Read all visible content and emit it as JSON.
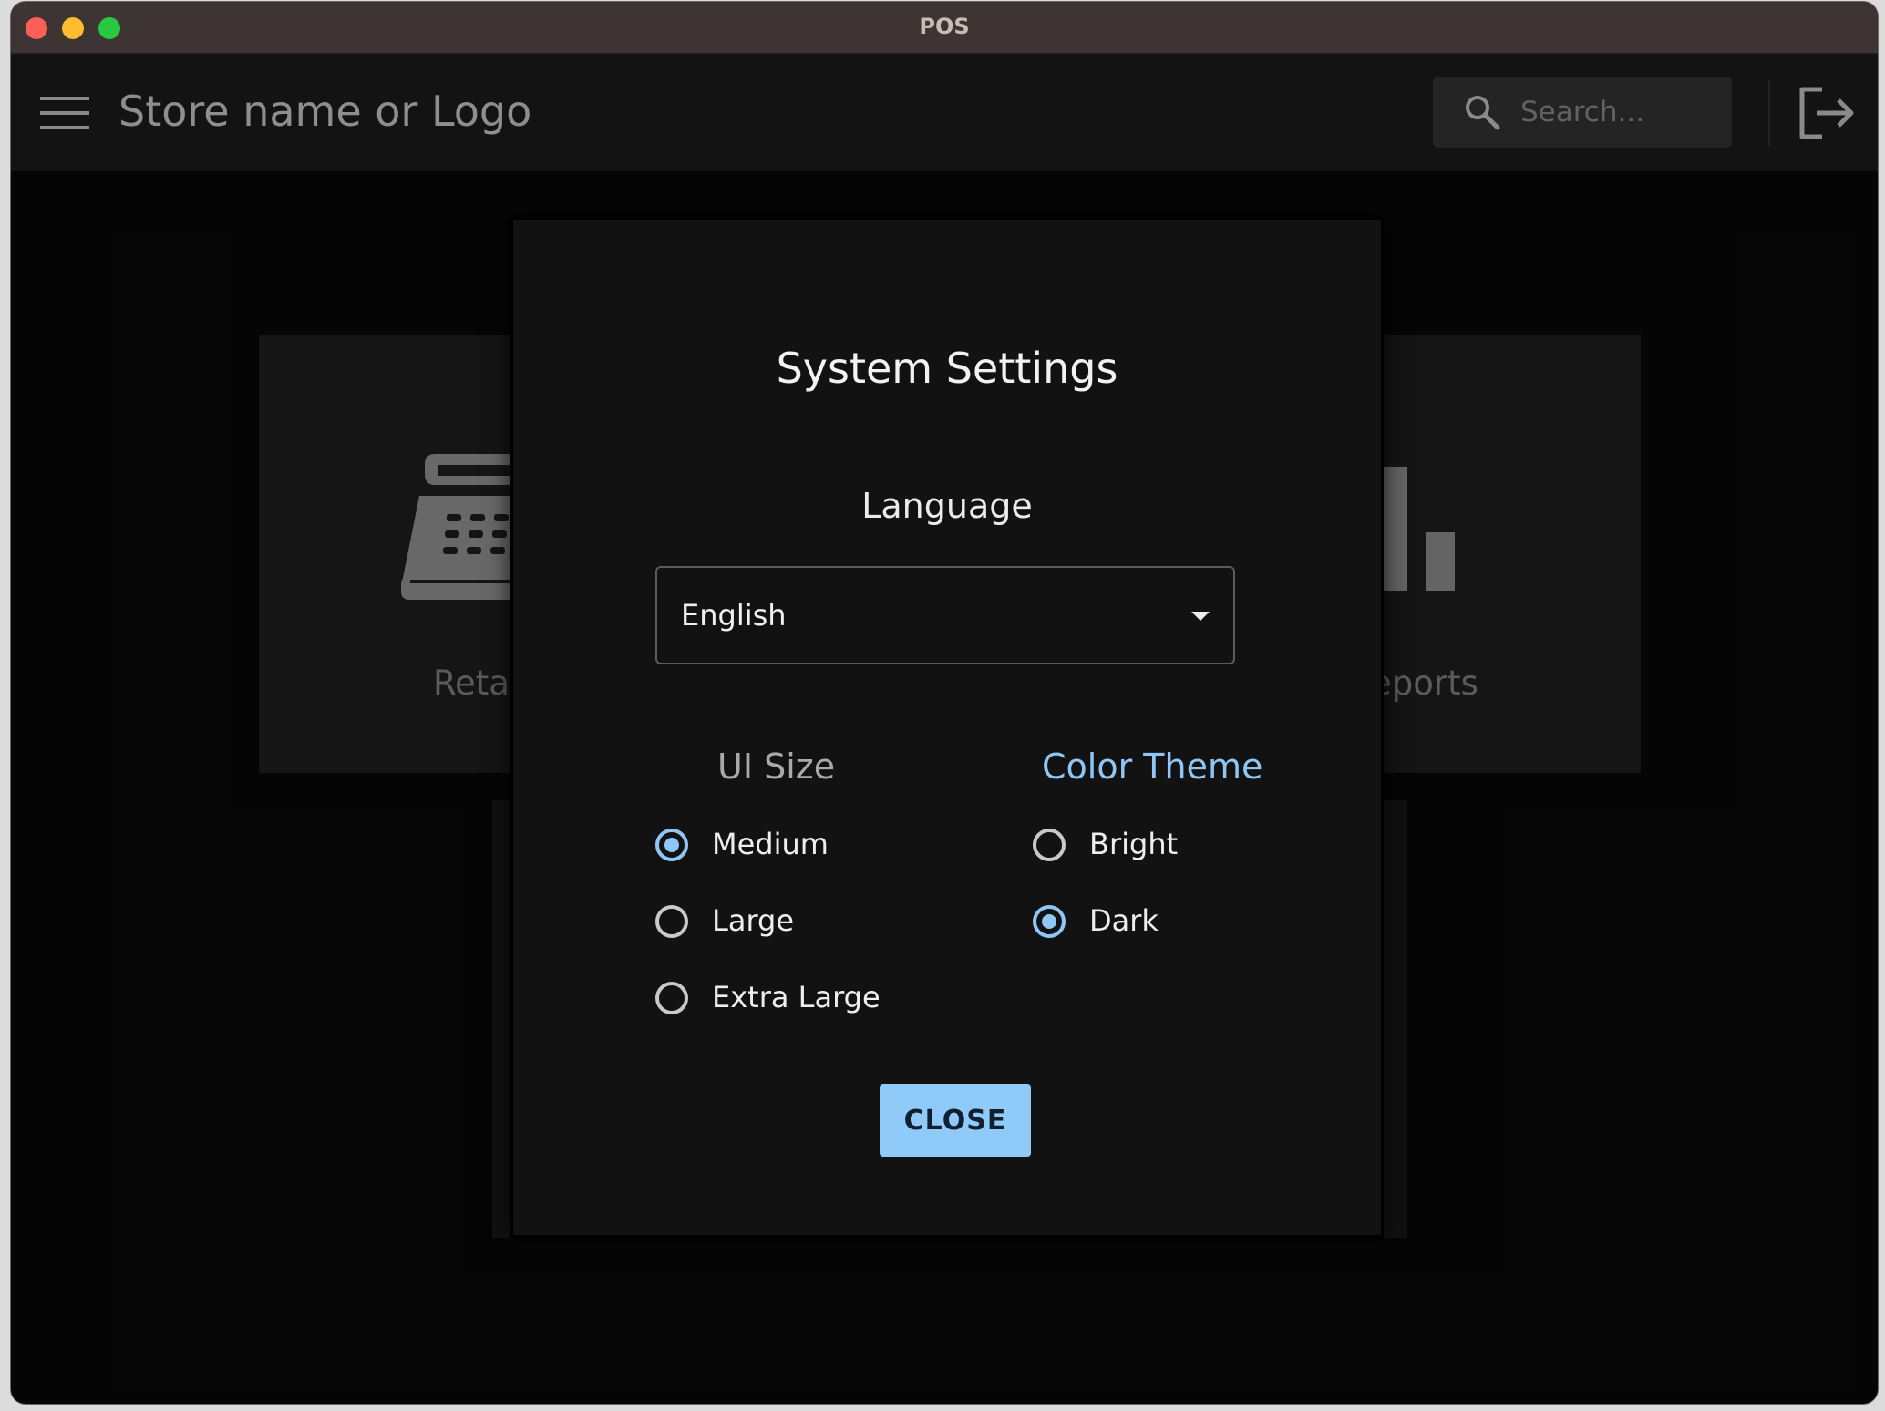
{
  "window": {
    "title": "POS"
  },
  "appbar": {
    "menu_icon": "menu-icon",
    "store_name": "Store name or Logo",
    "search": {
      "placeholder": "Search...",
      "value": "",
      "icon": "search-icon"
    },
    "logout_icon": "logout-icon"
  },
  "tiles": [
    {
      "label": "Retail",
      "icon": "cash-register-icon"
    },
    {
      "label": "Reports",
      "icon": "bar-chart-icon"
    }
  ],
  "dialog": {
    "title": "System Settings",
    "language": {
      "label": "Language",
      "selected": "English"
    },
    "ui_size": {
      "heading": "UI Size",
      "options": [
        {
          "label": "Medium",
          "checked": true
        },
        {
          "label": "Large",
          "checked": false
        },
        {
          "label": "Extra Large",
          "checked": false
        }
      ]
    },
    "color_theme": {
      "heading": "Color Theme",
      "options": [
        {
          "label": "Bright",
          "checked": false
        },
        {
          "label": "Dark",
          "checked": true
        }
      ]
    },
    "close_label": "CLOSE"
  },
  "colors": {
    "accent": "#90caf9",
    "dialog_bg": "#121212",
    "appbar_bg": "#131313",
    "titlebar_bg": "#3d3433"
  }
}
